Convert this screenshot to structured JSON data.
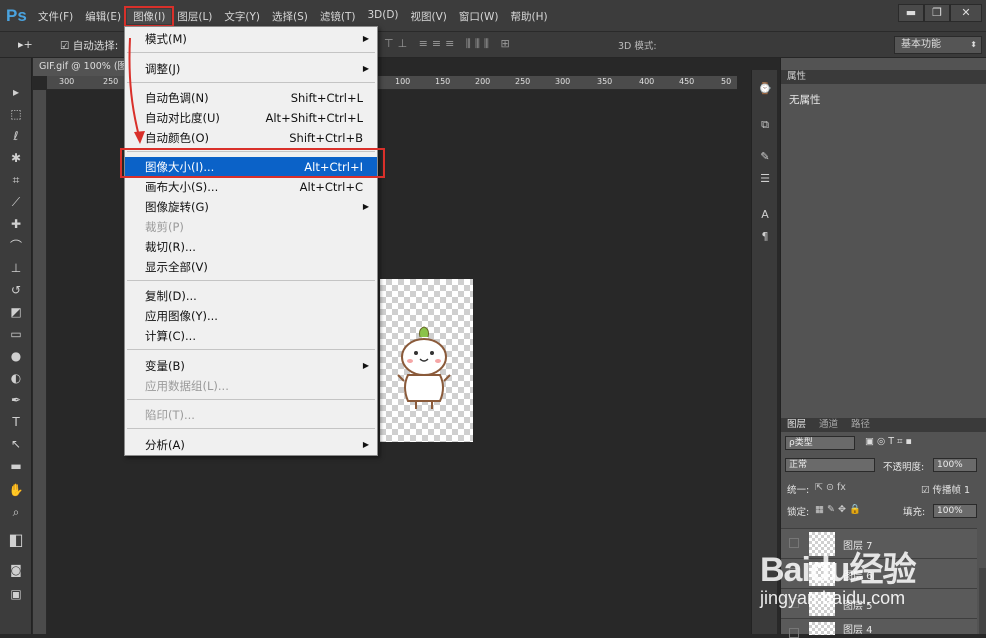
{
  "app": {
    "logo": "Ps",
    "menus": [
      "文件(F)",
      "编辑(E)",
      "图像(I)",
      "图层(L)",
      "文字(Y)",
      "选择(S)",
      "滤镜(T)",
      "3D(D)",
      "视图(V)",
      "窗口(W)",
      "帮助(H)"
    ],
    "active_menu_index": 2,
    "window_controls": {
      "minimize": "▬",
      "restore": "❐",
      "close": "✕"
    }
  },
  "options_bar": {
    "tool_glyph": "▸+",
    "auto_select": "☑ 自动选择:",
    "mode_label": "3D 模式:",
    "workspace": "基本功能"
  },
  "document": {
    "tab_title": "GIF.gif @ 100% (图",
    "ruler_labels": [
      "300",
      "250",
      "100",
      "150",
      "200",
      "250",
      "300",
      "350",
      "400",
      "450",
      "50"
    ]
  },
  "image_menu": {
    "items": [
      {
        "label": "模式(M)",
        "shortcut": "",
        "submenu": true,
        "disabled": false
      },
      {
        "label": "调整(J)",
        "shortcut": "",
        "submenu": true,
        "disabled": false
      },
      {
        "label": "自动色调(N)",
        "shortcut": "Shift+Ctrl+L",
        "submenu": false,
        "disabled": false
      },
      {
        "label": "自动对比度(U)",
        "shortcut": "Alt+Shift+Ctrl+L",
        "submenu": false,
        "disabled": false
      },
      {
        "label": "自动颜色(O)",
        "shortcut": "Shift+Ctrl+B",
        "submenu": false,
        "disabled": false
      },
      {
        "label": "图像大小(I)...",
        "shortcut": "Alt+Ctrl+I",
        "submenu": false,
        "disabled": false,
        "highlighted": true
      },
      {
        "label": "画布大小(S)...",
        "shortcut": "Alt+Ctrl+C",
        "submenu": false,
        "disabled": false
      },
      {
        "label": "图像旋转(G)",
        "shortcut": "",
        "submenu": true,
        "disabled": false
      },
      {
        "label": "裁剪(P)",
        "shortcut": "",
        "submenu": false,
        "disabled": true
      },
      {
        "label": "裁切(R)...",
        "shortcut": "",
        "submenu": false,
        "disabled": false
      },
      {
        "label": "显示全部(V)",
        "shortcut": "",
        "submenu": false,
        "disabled": false
      },
      {
        "label": "复制(D)...",
        "shortcut": "",
        "submenu": false,
        "disabled": false
      },
      {
        "label": "应用图像(Y)...",
        "shortcut": "",
        "submenu": false,
        "disabled": false
      },
      {
        "label": "计算(C)...",
        "shortcut": "",
        "submenu": false,
        "disabled": false
      },
      {
        "label": "变量(B)",
        "shortcut": "",
        "submenu": true,
        "disabled": false
      },
      {
        "label": "应用数据组(L)...",
        "shortcut": "",
        "submenu": false,
        "disabled": true
      },
      {
        "label": "陷印(T)...",
        "shortcut": "",
        "submenu": false,
        "disabled": true
      },
      {
        "label": "分析(A)",
        "shortcut": "",
        "submenu": true,
        "disabled": false
      }
    ]
  },
  "properties_panel": {
    "title": "属性",
    "content": "无属性"
  },
  "layers_panel": {
    "tabs": [
      "图层",
      "通道",
      "路径"
    ],
    "filter_label": "ρ类型",
    "blend_mode": "正常",
    "opacity_label": "不透明度:",
    "opacity_value": "100%",
    "unify_label": "统一:",
    "propagate_label": "☑ 传播帧 1",
    "lock_label": "锁定:",
    "fill_label": "填充:",
    "fill_value": "100%",
    "layers": [
      "图层 7",
      "图层 6",
      "图层 5",
      "图层 4"
    ]
  },
  "watermark": {
    "brand": "Baidu经验",
    "url": "jingyan.baidu.com"
  },
  "colors": {
    "menu_highlight": "#0b62c8",
    "annotation_red": "#d9302a"
  }
}
